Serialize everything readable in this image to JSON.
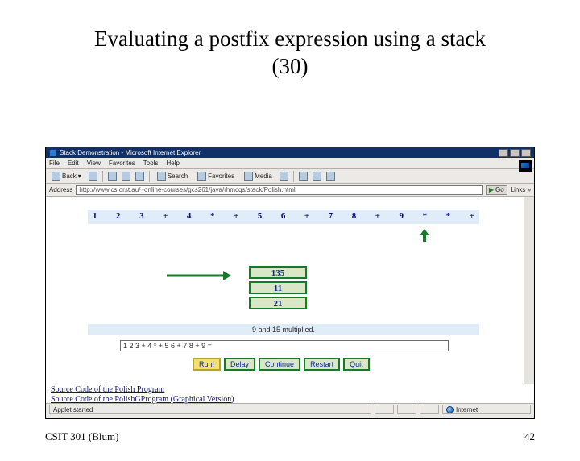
{
  "slide": {
    "title_line1": "Evaluating a postfix expression using a stack",
    "title_line2": "(30)",
    "footer_left": "CSIT 301 (Blum)",
    "footer_right": "42"
  },
  "browser": {
    "window_title": "Stack Demonstration - Microsoft Internet Explorer",
    "menus": [
      "File",
      "Edit",
      "View",
      "Favorites",
      "Tools",
      "Help"
    ],
    "toolbar": {
      "back": "Back",
      "search": "Search",
      "favorites": "Favorites",
      "media": "Media"
    },
    "address_label": "Address",
    "address_value": "http://www.cs.orst.au/~online-courses/gcs261/java/rhmcqs/stack/Polish.html",
    "go_label": "Go",
    "links_label": "Links »"
  },
  "applet": {
    "expression_tokens": [
      "1",
      "2",
      "3",
      "+",
      "4",
      "*",
      "+",
      "5",
      "6",
      "+",
      "7",
      "8",
      "+",
      "9",
      "*",
      "*",
      "+"
    ],
    "cursor_index": 14,
    "stack_values": [
      "135",
      "11",
      "21"
    ],
    "message": "9 and 15 multiplied.",
    "input_value": "1 2 3 + 4 * + 5 6 + 7 8 + 9   =",
    "buttons": {
      "run": "Run!",
      "delay": "Delay",
      "continue": "Continue",
      "restart": "Restart",
      "quit": "Quit"
    },
    "source_links": [
      "Source Code of the Polish Program",
      "Source Code of the PolishGProgram (Graphical Version)"
    ]
  },
  "status": {
    "left": "Applet started",
    "right": "Internet"
  },
  "colors": {
    "stack_border": "#167a28",
    "stack_fill": "#d9e7c7",
    "link_blue": "#121276",
    "band_blue": "#e1ecf9"
  }
}
